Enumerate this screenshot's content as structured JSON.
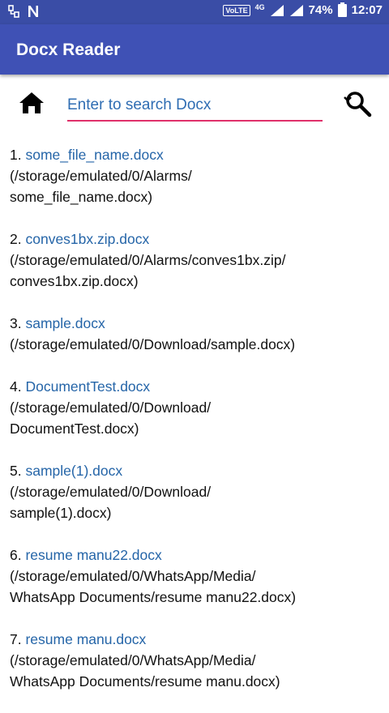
{
  "status_bar": {
    "volte": "VoLTE",
    "network": "4G",
    "battery": "74%",
    "time": "12:07"
  },
  "app_bar": {
    "title": "Docx Reader"
  },
  "search": {
    "placeholder": "Enter to search Docx"
  },
  "colors": {
    "app_bar": "#3f51b5",
    "status_bar": "#3a4da6",
    "link": "#2565a8",
    "input_underline": "#e0306a"
  },
  "files": [
    {
      "index": "1.",
      "name": "some_file_name.docx",
      "path_line1": "(/storage/emulated/0/Alarms/",
      "path_line2": "some_file_name.docx)"
    },
    {
      "index": "2.",
      "name": "conves1bx.zip.docx",
      "path_line1": "(/storage/emulated/0/Alarms/conves1bx.zip/",
      "path_line2": "conves1bx.zip.docx)"
    },
    {
      "index": "3.",
      "name": "sample.docx",
      "path_line1": "(/storage/emulated/0/Download/sample.docx)",
      "path_line2": ""
    },
    {
      "index": "4.",
      "name": "DocumentTest.docx",
      "path_line1": "(/storage/emulated/0/Download/",
      "path_line2": "DocumentTest.docx)"
    },
    {
      "index": "5.",
      "name": "sample(1).docx",
      "path_line1": "(/storage/emulated/0/Download/",
      "path_line2": "sample(1).docx)"
    },
    {
      "index": "6.",
      "name": "resume manu22.docx",
      "path_line1": "(/storage/emulated/0/WhatsApp/Media/",
      "path_line2": "WhatsApp Documents/resume manu22.docx)"
    },
    {
      "index": "7.",
      "name": "resume manu.docx",
      "path_line1": "(/storage/emulated/0/WhatsApp/Media/",
      "path_line2": "WhatsApp Documents/resume manu.docx)"
    }
  ]
}
